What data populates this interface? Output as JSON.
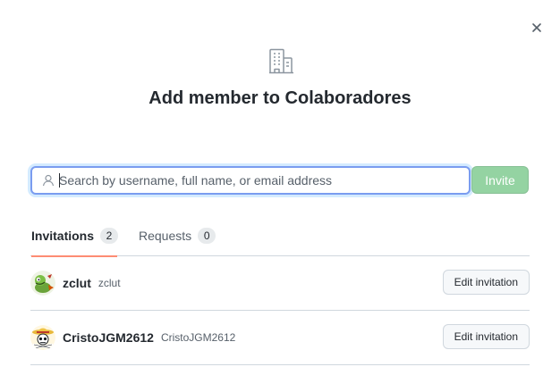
{
  "dialog": {
    "title": "Add member to Colaboradores",
    "close_icon": "close-icon",
    "org_icon": "organization-icon"
  },
  "search": {
    "placeholder": "Search by username, full name, or email address",
    "value": "",
    "icon": "person-icon"
  },
  "invite_button": {
    "label": "Invite",
    "disabled": true,
    "color": "#94d3a2"
  },
  "tabs": [
    {
      "label": "Invitations",
      "count": "2",
      "active": true
    },
    {
      "label": "Requests",
      "count": "0",
      "active": false
    }
  ],
  "invitations": [
    {
      "login": "zclut",
      "full_name": "zclut",
      "action": "Edit invitation",
      "avatar": "green-cartoon-avatar"
    },
    {
      "login": "CristoJGM2612",
      "full_name": "CristoJGM2612",
      "action": "Edit invitation",
      "avatar": "straw-hat-skull-avatar"
    }
  ],
  "colors": {
    "active_tab_underline": "#fd8c73",
    "focus_border": "#7a9cf0"
  }
}
